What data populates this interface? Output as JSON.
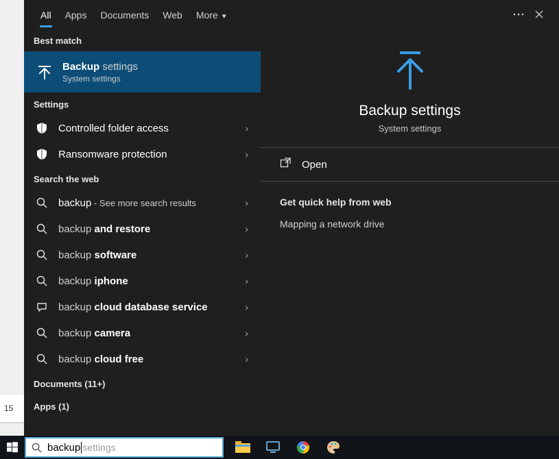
{
  "tabs": {
    "all": "All",
    "apps": "Apps",
    "documents": "Documents",
    "web": "Web",
    "more": "More"
  },
  "bestMatch": {
    "label": "Best match",
    "item": {
      "title_strong": "Backup",
      "title_weak": "settings",
      "subtitle": "System settings"
    }
  },
  "settings": {
    "label": "Settings",
    "items": [
      {
        "text": "Controlled folder access"
      },
      {
        "text": "Ransomware protection"
      }
    ]
  },
  "searchWeb": {
    "label": "Search the web",
    "items": [
      {
        "prefix": "backup",
        "suffix": " - See more search results"
      },
      {
        "prefix": "backup ",
        "suffix_bold": "and restore"
      },
      {
        "prefix": "backup ",
        "suffix_bold": "software"
      },
      {
        "prefix": "backup ",
        "suffix_bold": "iphone"
      },
      {
        "prefix": "backup ",
        "suffix_bold": "cloud database service"
      },
      {
        "prefix": "backup ",
        "suffix_bold": "camera"
      },
      {
        "prefix": "backup ",
        "suffix_bold": "cloud free"
      }
    ]
  },
  "documents": {
    "label": "Documents (11+)"
  },
  "apps": {
    "label": "Apps (1)"
  },
  "preview": {
    "title": "Backup settings",
    "subtitle": "System settings",
    "open": "Open",
    "quickHelp": "Get quick help from web",
    "link1": "Mapping a network drive"
  },
  "search": {
    "query": "backup",
    "placeholder": "settings"
  },
  "dateChip": "15"
}
